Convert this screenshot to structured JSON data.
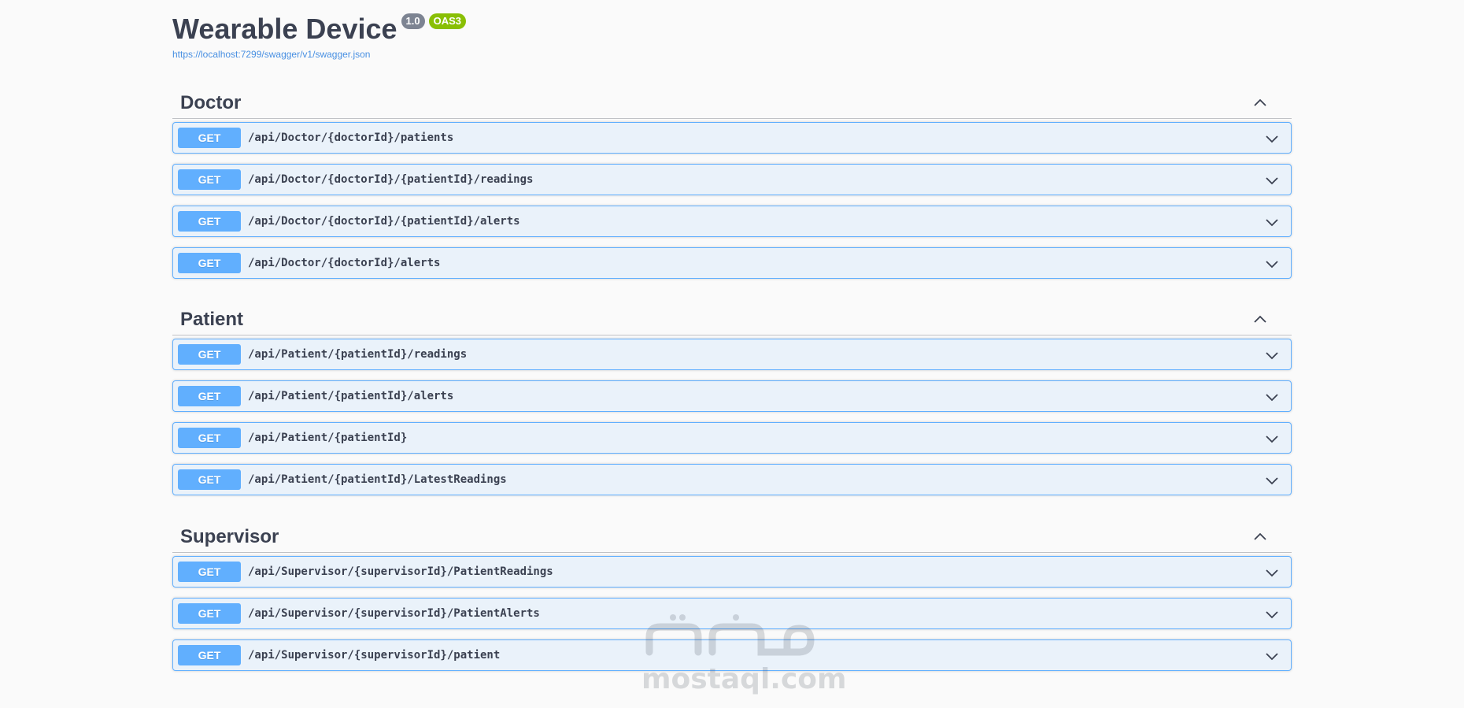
{
  "info": {
    "title": "Wearable Device",
    "version": "1.0",
    "oas": "OAS3",
    "spec_url": "https://localhost:7299/swagger/v1/swagger.json"
  },
  "colors": {
    "get_method": "#61affe",
    "badge_version": "#7d8492",
    "badge_oas": "#89bf04",
    "link": "#4990e2",
    "text": "#3b4151"
  },
  "icons": {
    "collapse": "chevron-up-icon",
    "expand": "chevron-down-icon"
  },
  "sections": [
    {
      "name": "Doctor",
      "operations": [
        {
          "method": "GET",
          "path": "/api/Doctor/{doctorId}/patients"
        },
        {
          "method": "GET",
          "path": "/api/Doctor/{doctorId}/{patientId}/readings"
        },
        {
          "method": "GET",
          "path": "/api/Doctor/{doctorId}/{patientId}/alerts"
        },
        {
          "method": "GET",
          "path": "/api/Doctor/{doctorId}/alerts"
        }
      ]
    },
    {
      "name": "Patient",
      "operations": [
        {
          "method": "GET",
          "path": "/api/Patient/{patientId}/readings"
        },
        {
          "method": "GET",
          "path": "/api/Patient/{patientId}/alerts"
        },
        {
          "method": "GET",
          "path": "/api/Patient/{patientId}"
        },
        {
          "method": "GET",
          "path": "/api/Patient/{patientId}/LatestReadings"
        }
      ]
    },
    {
      "name": "Supervisor",
      "operations": [
        {
          "method": "GET",
          "path": "/api/Supervisor/{supervisorId}/PatientReadings"
        },
        {
          "method": "GET",
          "path": "/api/Supervisor/{supervisorId}/PatientAlerts"
        },
        {
          "method": "GET",
          "path": "/api/Supervisor/{supervisorId}/patient"
        }
      ]
    }
  ],
  "watermark": {
    "text": "mostaql.com"
  }
}
